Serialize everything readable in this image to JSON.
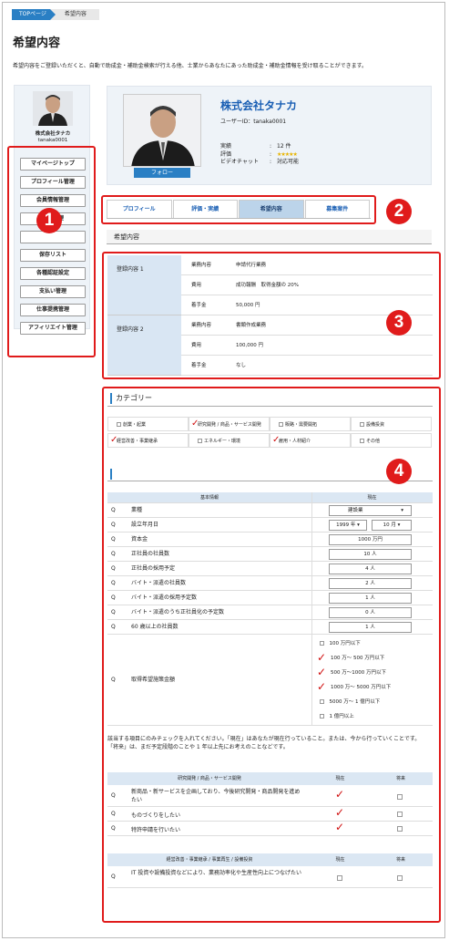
{
  "breadcrumb": {
    "home": "TOPページ",
    "current": "希望内容"
  },
  "page": {
    "title": "希望内容",
    "intro": "希望内容をご登録いただくと、自動で助成金・補助金検索が行える他、士業からあなたにあった助成金・補助金情報を受け取ることができます。"
  },
  "sidebar": {
    "company": "株式会社タナカ",
    "user": "tanaka0001",
    "menu": [
      "マイページトップ",
      "プロフィール管理",
      "会員情報管理",
      "仕事管理",
      "",
      "保存リスト",
      "各種認証設定",
      "支払い管理",
      "仕事提携管理",
      "アフィリエイト管理"
    ]
  },
  "badges": [
    "1",
    "2",
    "3",
    "4"
  ],
  "profile": {
    "company": "株式会社タナカ",
    "user_id": "ユーザーID：tanaka0001",
    "follow": "フォロー",
    "stats": [
      {
        "k": "実績",
        "v": "12 件"
      },
      {
        "k": "評価",
        "v": "★★★★★"
      },
      {
        "k": "ビデオチャット",
        "v": "対応可能"
      }
    ]
  },
  "tabs": [
    "プロフィール",
    "評価・実績",
    "希望内容",
    "募集案件"
  ],
  "section": {
    "wish": "希望内容",
    "category": "カテゴリー"
  },
  "registrations": [
    {
      "label": "登録内容 1",
      "rows": [
        {
          "k": "業務内容",
          "v": "申請代行業務"
        },
        {
          "k": "費用",
          "v": "成功報酬　取得金額の 20%"
        },
        {
          "k": "着手金",
          "v": "50,000 円"
        }
      ]
    },
    {
      "label": "登録内容 2",
      "rows": [
        {
          "k": "業務内容",
          "v": "書類作成業務"
        },
        {
          "k": "費用",
          "v": "100,000 円"
        },
        {
          "k": "着手金",
          "v": "なし"
        }
      ]
    }
  ],
  "categories": [
    {
      "label": "創業・起業",
      "checked": false
    },
    {
      "label": "研究開発 / 商品・サービス開発",
      "checked": true
    },
    {
      "label": "販路・需要開拓",
      "checked": false
    },
    {
      "label": "設備投資",
      "checked": false
    },
    {
      "label": "経営改善・事業継承",
      "checked": true
    },
    {
      "label": "エネルギー・環境",
      "checked": false
    },
    {
      "label": "雇用・人材紹介",
      "checked": true
    },
    {
      "label": "その他",
      "checked": false
    }
  ],
  "info_table": {
    "head_left": "基本情報",
    "head_right": "現在",
    "q": "Q",
    "rows": [
      {
        "label": "業種",
        "value": "建設業"
      },
      {
        "label": "設立年月日",
        "year": "1999 年",
        "month": "10 月"
      },
      {
        "label": "資本金",
        "value": "1000 万円"
      },
      {
        "label": "正社員の社員数",
        "value": "10 人"
      },
      {
        "label": "正社員の採用予定",
        "value": "4 人"
      },
      {
        "label": "バイト・派遣の社員数",
        "value": "2 人"
      },
      {
        "label": "バイト・派遣の採用予定数",
        "value": "1 人"
      },
      {
        "label": "バイト・派遣のうち正社員化の予定数",
        "value": "0 人"
      },
      {
        "label": "60 歳以上の社員数",
        "value": "1 人"
      }
    ],
    "amount_label": "取得希望施策金額",
    "amount_options": [
      {
        "label": "100 万円以下",
        "checked": false
      },
      {
        "label": "100 万～ 500 万円以下",
        "checked": true
      },
      {
        "label": "500 万～1000 万円以下",
        "checked": true
      },
      {
        "label": "1000 万～ 5000 万円以下",
        "checked": true
      },
      {
        "label": "5000 万～ 1 億円以下",
        "checked": false
      },
      {
        "label": "1 億円以上",
        "checked": false
      }
    ]
  },
  "note": "該当する項目にのみチェックを入れてください。「現在」はあなたが現在行っていること。または、今から行っていくことです。「将来」は、まだ予定段階のことや 1 年以上先にお考えのことなどです。",
  "table2": {
    "head": "研究開発 / 商品・サービス開発",
    "now": "現在",
    "future": "将来",
    "rows": [
      {
        "label": "新商品・新サービスを企画しており、今後研究開発・商品開発を進めたい",
        "now": true
      },
      {
        "label": "ものづくりをしたい",
        "now": true
      },
      {
        "label": "特許申請を行いたい",
        "now": true
      }
    ]
  },
  "table3": {
    "head": "経営改善・事業継承 / 事業再生 / 設備投資",
    "now": "現在",
    "future": "将来",
    "rows": [
      {
        "label": "IT 投資や設備投資などにより、業務効率化や生産性向上につなげたい"
      }
    ]
  },
  "colors": {
    "accent": "#2a7fc4",
    "highlight": "#e01b1b"
  }
}
